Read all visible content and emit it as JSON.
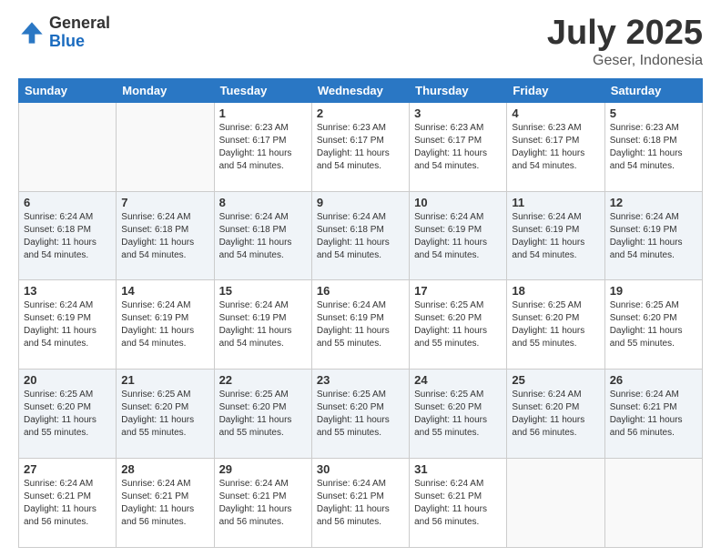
{
  "header": {
    "logo_general": "General",
    "logo_blue": "Blue",
    "title": "July 2025",
    "location": "Geser, Indonesia"
  },
  "days_of_week": [
    "Sunday",
    "Monday",
    "Tuesday",
    "Wednesday",
    "Thursday",
    "Friday",
    "Saturday"
  ],
  "weeks": [
    [
      {
        "day": "",
        "sunrise": "",
        "sunset": "",
        "daylight": ""
      },
      {
        "day": "",
        "sunrise": "",
        "sunset": "",
        "daylight": ""
      },
      {
        "day": "1",
        "sunrise": "Sunrise: 6:23 AM",
        "sunset": "Sunset: 6:17 PM",
        "daylight": "Daylight: 11 hours and 54 minutes."
      },
      {
        "day": "2",
        "sunrise": "Sunrise: 6:23 AM",
        "sunset": "Sunset: 6:17 PM",
        "daylight": "Daylight: 11 hours and 54 minutes."
      },
      {
        "day": "3",
        "sunrise": "Sunrise: 6:23 AM",
        "sunset": "Sunset: 6:17 PM",
        "daylight": "Daylight: 11 hours and 54 minutes."
      },
      {
        "day": "4",
        "sunrise": "Sunrise: 6:23 AM",
        "sunset": "Sunset: 6:17 PM",
        "daylight": "Daylight: 11 hours and 54 minutes."
      },
      {
        "day": "5",
        "sunrise": "Sunrise: 6:23 AM",
        "sunset": "Sunset: 6:18 PM",
        "daylight": "Daylight: 11 hours and 54 minutes."
      }
    ],
    [
      {
        "day": "6",
        "sunrise": "Sunrise: 6:24 AM",
        "sunset": "Sunset: 6:18 PM",
        "daylight": "Daylight: 11 hours and 54 minutes."
      },
      {
        "day": "7",
        "sunrise": "Sunrise: 6:24 AM",
        "sunset": "Sunset: 6:18 PM",
        "daylight": "Daylight: 11 hours and 54 minutes."
      },
      {
        "day": "8",
        "sunrise": "Sunrise: 6:24 AM",
        "sunset": "Sunset: 6:18 PM",
        "daylight": "Daylight: 11 hours and 54 minutes."
      },
      {
        "day": "9",
        "sunrise": "Sunrise: 6:24 AM",
        "sunset": "Sunset: 6:18 PM",
        "daylight": "Daylight: 11 hours and 54 minutes."
      },
      {
        "day": "10",
        "sunrise": "Sunrise: 6:24 AM",
        "sunset": "Sunset: 6:19 PM",
        "daylight": "Daylight: 11 hours and 54 minutes."
      },
      {
        "day": "11",
        "sunrise": "Sunrise: 6:24 AM",
        "sunset": "Sunset: 6:19 PM",
        "daylight": "Daylight: 11 hours and 54 minutes."
      },
      {
        "day": "12",
        "sunrise": "Sunrise: 6:24 AM",
        "sunset": "Sunset: 6:19 PM",
        "daylight": "Daylight: 11 hours and 54 minutes."
      }
    ],
    [
      {
        "day": "13",
        "sunrise": "Sunrise: 6:24 AM",
        "sunset": "Sunset: 6:19 PM",
        "daylight": "Daylight: 11 hours and 54 minutes."
      },
      {
        "day": "14",
        "sunrise": "Sunrise: 6:24 AM",
        "sunset": "Sunset: 6:19 PM",
        "daylight": "Daylight: 11 hours and 54 minutes."
      },
      {
        "day": "15",
        "sunrise": "Sunrise: 6:24 AM",
        "sunset": "Sunset: 6:19 PM",
        "daylight": "Daylight: 11 hours and 54 minutes."
      },
      {
        "day": "16",
        "sunrise": "Sunrise: 6:24 AM",
        "sunset": "Sunset: 6:19 PM",
        "daylight": "Daylight: 11 hours and 55 minutes."
      },
      {
        "day": "17",
        "sunrise": "Sunrise: 6:25 AM",
        "sunset": "Sunset: 6:20 PM",
        "daylight": "Daylight: 11 hours and 55 minutes."
      },
      {
        "day": "18",
        "sunrise": "Sunrise: 6:25 AM",
        "sunset": "Sunset: 6:20 PM",
        "daylight": "Daylight: 11 hours and 55 minutes."
      },
      {
        "day": "19",
        "sunrise": "Sunrise: 6:25 AM",
        "sunset": "Sunset: 6:20 PM",
        "daylight": "Daylight: 11 hours and 55 minutes."
      }
    ],
    [
      {
        "day": "20",
        "sunrise": "Sunrise: 6:25 AM",
        "sunset": "Sunset: 6:20 PM",
        "daylight": "Daylight: 11 hours and 55 minutes."
      },
      {
        "day": "21",
        "sunrise": "Sunrise: 6:25 AM",
        "sunset": "Sunset: 6:20 PM",
        "daylight": "Daylight: 11 hours and 55 minutes."
      },
      {
        "day": "22",
        "sunrise": "Sunrise: 6:25 AM",
        "sunset": "Sunset: 6:20 PM",
        "daylight": "Daylight: 11 hours and 55 minutes."
      },
      {
        "day": "23",
        "sunrise": "Sunrise: 6:25 AM",
        "sunset": "Sunset: 6:20 PM",
        "daylight": "Daylight: 11 hours and 55 minutes."
      },
      {
        "day": "24",
        "sunrise": "Sunrise: 6:25 AM",
        "sunset": "Sunset: 6:20 PM",
        "daylight": "Daylight: 11 hours and 55 minutes."
      },
      {
        "day": "25",
        "sunrise": "Sunrise: 6:24 AM",
        "sunset": "Sunset: 6:20 PM",
        "daylight": "Daylight: 11 hours and 56 minutes."
      },
      {
        "day": "26",
        "sunrise": "Sunrise: 6:24 AM",
        "sunset": "Sunset: 6:21 PM",
        "daylight": "Daylight: 11 hours and 56 minutes."
      }
    ],
    [
      {
        "day": "27",
        "sunrise": "Sunrise: 6:24 AM",
        "sunset": "Sunset: 6:21 PM",
        "daylight": "Daylight: 11 hours and 56 minutes."
      },
      {
        "day": "28",
        "sunrise": "Sunrise: 6:24 AM",
        "sunset": "Sunset: 6:21 PM",
        "daylight": "Daylight: 11 hours and 56 minutes."
      },
      {
        "day": "29",
        "sunrise": "Sunrise: 6:24 AM",
        "sunset": "Sunset: 6:21 PM",
        "daylight": "Daylight: 11 hours and 56 minutes."
      },
      {
        "day": "30",
        "sunrise": "Sunrise: 6:24 AM",
        "sunset": "Sunset: 6:21 PM",
        "daylight": "Daylight: 11 hours and 56 minutes."
      },
      {
        "day": "31",
        "sunrise": "Sunrise: 6:24 AM",
        "sunset": "Sunset: 6:21 PM",
        "daylight": "Daylight: 11 hours and 56 minutes."
      },
      {
        "day": "",
        "sunrise": "",
        "sunset": "",
        "daylight": ""
      },
      {
        "day": "",
        "sunrise": "",
        "sunset": "",
        "daylight": ""
      }
    ]
  ]
}
